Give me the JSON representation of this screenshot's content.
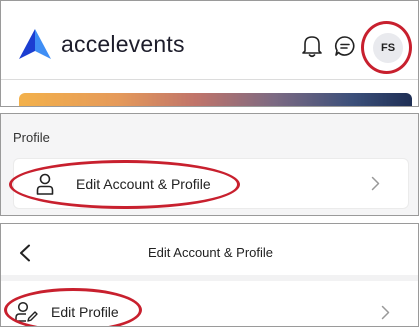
{
  "header": {
    "brand": "accelevents",
    "avatar_initials": "FS",
    "logo_colors": {
      "left": "#1c3ed1",
      "right": "#3f8ef5"
    }
  },
  "icons": {
    "logo": "accelevents-logo-icon",
    "notifications": "bell-icon",
    "messages": "chat-bubble-icon",
    "account": "user-icon",
    "edit_profile": "user-edit-icon",
    "chevron": "chevron-right-icon",
    "back": "chevron-left-icon"
  },
  "profile_section": {
    "title": "Profile",
    "row_label": "Edit Account & Profile"
  },
  "edit_account": {
    "nav_title": "Edit Account & Profile",
    "row_label": "Edit Profile"
  },
  "highlight_color": "#c8202e"
}
